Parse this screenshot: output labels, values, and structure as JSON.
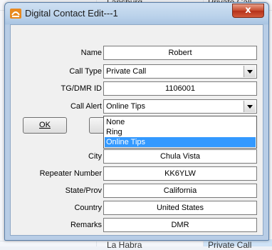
{
  "background": {
    "top_left_text": "Lansburg",
    "top_right_text": "Private Call",
    "bottom_left_text": "La Habra",
    "bottom_right_text": "Private Call"
  },
  "window": {
    "title": "Digital Contact Edit---1",
    "close_label": "x"
  },
  "form": {
    "name": {
      "label": "Name",
      "value": "Robert"
    },
    "call_type": {
      "label": "Call Type",
      "value": "Private Call"
    },
    "tg_dmr_id": {
      "label": "TG/DMR ID",
      "value": "1106001"
    },
    "call_alert": {
      "label": "Call Alert",
      "value": "Online Tips",
      "options": [
        "None",
        "Ring",
        "Online Tips"
      ],
      "selected_index": 2
    },
    "city": {
      "label": "City",
      "value": "Chula Vista"
    },
    "repeater_number": {
      "label": "Repeater Number",
      "value": "KK6YLW"
    },
    "state_prov": {
      "label": "State/Prov",
      "value": "California"
    },
    "country": {
      "label": "Country",
      "value": "United States"
    },
    "remarks": {
      "label": "Remarks",
      "value": "DMR"
    }
  },
  "buttons": {
    "ok_label": "OK"
  },
  "colors": {
    "selection": "#3399ff",
    "close_button": "#c74a2c"
  }
}
